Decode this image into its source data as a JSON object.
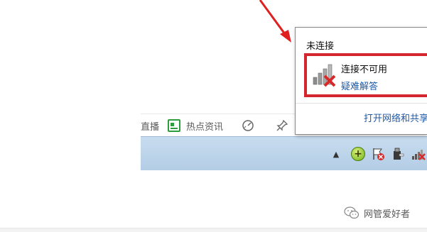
{
  "browser_bar": {
    "live_label": "直播",
    "news_label": "热点资讯",
    "news_icon": "news-icon",
    "speed_icon": "speedometer-icon",
    "pin_icon": "pin-icon"
  },
  "popup": {
    "title": "未连接",
    "status": "连接不可用",
    "troubleshoot": "疑难解答",
    "open_network": "打开网络和共享中心",
    "signal_icon": "no-connection-icon"
  },
  "taskbar": {
    "tray_icons": [
      "show-hidden-icons",
      "add-icon",
      "action-center-flag-icon",
      "usb-device-icon",
      "network-disconnected-icon"
    ]
  },
  "watermark": {
    "text": "网管爱好者",
    "icon": "wechat-icon"
  },
  "colors": {
    "highlight": "#d4262e",
    "link": "#1e5aa8",
    "taskbar": "#c3d8ec"
  }
}
